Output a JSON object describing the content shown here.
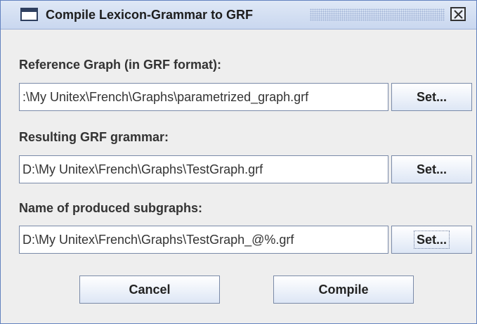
{
  "window": {
    "title": "Compile Lexicon-Grammar to GRF"
  },
  "reference": {
    "label": "Reference Graph (in GRF format):",
    "value": ":\\My Unitex\\French\\Graphs\\parametrized_graph.grf",
    "button": "Set..."
  },
  "resulting": {
    "label": "Resulting GRF grammar:",
    "value": "D:\\My Unitex\\French\\Graphs\\TestGraph.grf",
    "button": "Set..."
  },
  "subgraphs": {
    "label": "Name of produced subgraphs:",
    "value": "D:\\My Unitex\\French\\Graphs\\TestGraph_@%.grf",
    "button": "Set..."
  },
  "actions": {
    "cancel": "Cancel",
    "compile": "Compile"
  }
}
